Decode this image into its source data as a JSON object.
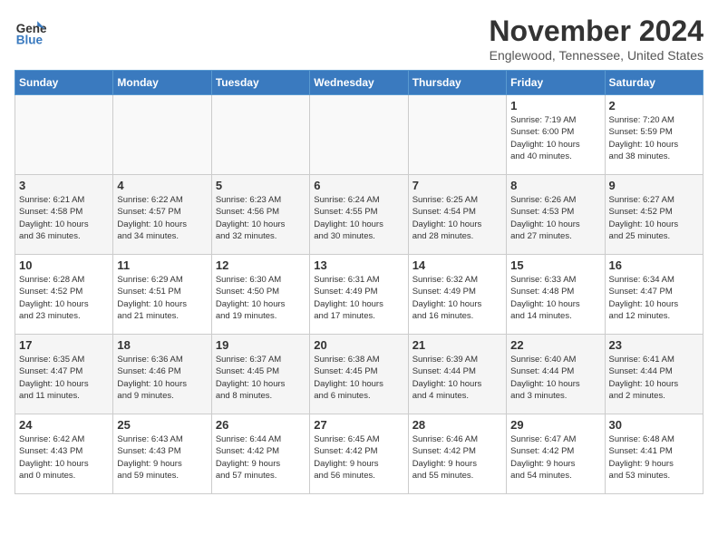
{
  "logo": {
    "line1": "General",
    "line2": "Blue"
  },
  "title": "November 2024",
  "location": "Englewood, Tennessee, United States",
  "days_of_week": [
    "Sunday",
    "Monday",
    "Tuesday",
    "Wednesday",
    "Thursday",
    "Friday",
    "Saturday"
  ],
  "weeks": [
    [
      {
        "day": "",
        "info": ""
      },
      {
        "day": "",
        "info": ""
      },
      {
        "day": "",
        "info": ""
      },
      {
        "day": "",
        "info": ""
      },
      {
        "day": "",
        "info": ""
      },
      {
        "day": "1",
        "info": "Sunrise: 7:19 AM\nSunset: 6:00 PM\nDaylight: 10 hours\nand 40 minutes."
      },
      {
        "day": "2",
        "info": "Sunrise: 7:20 AM\nSunset: 5:59 PM\nDaylight: 10 hours\nand 38 minutes."
      }
    ],
    [
      {
        "day": "3",
        "info": "Sunrise: 6:21 AM\nSunset: 4:58 PM\nDaylight: 10 hours\nand 36 minutes."
      },
      {
        "day": "4",
        "info": "Sunrise: 6:22 AM\nSunset: 4:57 PM\nDaylight: 10 hours\nand 34 minutes."
      },
      {
        "day": "5",
        "info": "Sunrise: 6:23 AM\nSunset: 4:56 PM\nDaylight: 10 hours\nand 32 minutes."
      },
      {
        "day": "6",
        "info": "Sunrise: 6:24 AM\nSunset: 4:55 PM\nDaylight: 10 hours\nand 30 minutes."
      },
      {
        "day": "7",
        "info": "Sunrise: 6:25 AM\nSunset: 4:54 PM\nDaylight: 10 hours\nand 28 minutes."
      },
      {
        "day": "8",
        "info": "Sunrise: 6:26 AM\nSunset: 4:53 PM\nDaylight: 10 hours\nand 27 minutes."
      },
      {
        "day": "9",
        "info": "Sunrise: 6:27 AM\nSunset: 4:52 PM\nDaylight: 10 hours\nand 25 minutes."
      }
    ],
    [
      {
        "day": "10",
        "info": "Sunrise: 6:28 AM\nSunset: 4:52 PM\nDaylight: 10 hours\nand 23 minutes."
      },
      {
        "day": "11",
        "info": "Sunrise: 6:29 AM\nSunset: 4:51 PM\nDaylight: 10 hours\nand 21 minutes."
      },
      {
        "day": "12",
        "info": "Sunrise: 6:30 AM\nSunset: 4:50 PM\nDaylight: 10 hours\nand 19 minutes."
      },
      {
        "day": "13",
        "info": "Sunrise: 6:31 AM\nSunset: 4:49 PM\nDaylight: 10 hours\nand 17 minutes."
      },
      {
        "day": "14",
        "info": "Sunrise: 6:32 AM\nSunset: 4:49 PM\nDaylight: 10 hours\nand 16 minutes."
      },
      {
        "day": "15",
        "info": "Sunrise: 6:33 AM\nSunset: 4:48 PM\nDaylight: 10 hours\nand 14 minutes."
      },
      {
        "day": "16",
        "info": "Sunrise: 6:34 AM\nSunset: 4:47 PM\nDaylight: 10 hours\nand 12 minutes."
      }
    ],
    [
      {
        "day": "17",
        "info": "Sunrise: 6:35 AM\nSunset: 4:47 PM\nDaylight: 10 hours\nand 11 minutes."
      },
      {
        "day": "18",
        "info": "Sunrise: 6:36 AM\nSunset: 4:46 PM\nDaylight: 10 hours\nand 9 minutes."
      },
      {
        "day": "19",
        "info": "Sunrise: 6:37 AM\nSunset: 4:45 PM\nDaylight: 10 hours\nand 8 minutes."
      },
      {
        "day": "20",
        "info": "Sunrise: 6:38 AM\nSunset: 4:45 PM\nDaylight: 10 hours\nand 6 minutes."
      },
      {
        "day": "21",
        "info": "Sunrise: 6:39 AM\nSunset: 4:44 PM\nDaylight: 10 hours\nand 4 minutes."
      },
      {
        "day": "22",
        "info": "Sunrise: 6:40 AM\nSunset: 4:44 PM\nDaylight: 10 hours\nand 3 minutes."
      },
      {
        "day": "23",
        "info": "Sunrise: 6:41 AM\nSunset: 4:44 PM\nDaylight: 10 hours\nand 2 minutes."
      }
    ],
    [
      {
        "day": "24",
        "info": "Sunrise: 6:42 AM\nSunset: 4:43 PM\nDaylight: 10 hours\nand 0 minutes."
      },
      {
        "day": "25",
        "info": "Sunrise: 6:43 AM\nSunset: 4:43 PM\nDaylight: 9 hours\nand 59 minutes."
      },
      {
        "day": "26",
        "info": "Sunrise: 6:44 AM\nSunset: 4:42 PM\nDaylight: 9 hours\nand 57 minutes."
      },
      {
        "day": "27",
        "info": "Sunrise: 6:45 AM\nSunset: 4:42 PM\nDaylight: 9 hours\nand 56 minutes."
      },
      {
        "day": "28",
        "info": "Sunrise: 6:46 AM\nSunset: 4:42 PM\nDaylight: 9 hours\nand 55 minutes."
      },
      {
        "day": "29",
        "info": "Sunrise: 6:47 AM\nSunset: 4:42 PM\nDaylight: 9 hours\nand 54 minutes."
      },
      {
        "day": "30",
        "info": "Sunrise: 6:48 AM\nSunset: 4:41 PM\nDaylight: 9 hours\nand 53 minutes."
      }
    ]
  ]
}
